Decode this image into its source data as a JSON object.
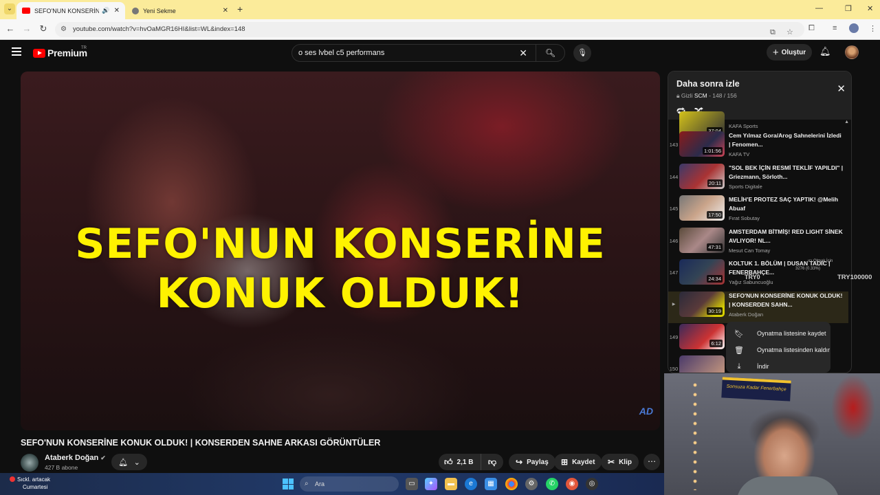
{
  "browser": {
    "tabs": [
      {
        "title": "SEFO'NUN KONSERİNE KO",
        "active": true
      },
      {
        "title": "Yeni Sekme",
        "active": false
      }
    ],
    "url": "youtube.com/watch?v=hvOaMGR16HI&list=WL&index=148"
  },
  "header": {
    "logo_text": "Premium",
    "logo_region": "TR",
    "search_query": "o ses lvbel c5 performans",
    "create_label": "Oluştur"
  },
  "video": {
    "overlay_line1": "SEFO'NUN KONSERİNE",
    "overlay_line2": "KONUK OLDUK!",
    "title": "SEFO'NUN KONSERİNE KONUK OLDUK! | KONSERDEN SAHNE ARKASI GÖRÜNTÜLER",
    "channel": "Ataberk Doğan",
    "subscribers": "427 B abone",
    "likes": "2,1 B",
    "share_label": "Paylaş",
    "save_label": "Kaydet",
    "clip_label": "Klip"
  },
  "playlist": {
    "title": "Daha sonra izle",
    "privacy": "Gizli",
    "owner": "SCM",
    "position": "148 / 156",
    "partial_top": {
      "duration": "37:04",
      "channel": "KAFA Sports"
    },
    "items": [
      {
        "index": "143",
        "title": "Cem Yılmaz Gora/Arog Sahnelerini İzledi | Fenomen...",
        "channel": "KAFA TV",
        "duration": "1:01:56"
      },
      {
        "index": "144",
        "title": "\"SOL BEK İÇİN RESMİ TEKLİF YAPILDI\" | Griezmann, Sörloth...",
        "channel": "Sports Digitale",
        "duration": "20:11"
      },
      {
        "index": "145",
        "title": "MELİH'E PROTEZ SAÇ YAPTIK! @Melih Abuaf",
        "channel": "Fırat Sobutay",
        "duration": "17:50"
      },
      {
        "index": "146",
        "title": "AMSTERDAM BİTMİŞ! RED LIGHT SİNEK AVLIYOR! NL...",
        "channel": "Mesut Can Tomay",
        "duration": "47:31"
      },
      {
        "index": "147",
        "title": "KOLTUK 1. BÖLÜM | DUSAN TADIC | FENERBAHÇE...",
        "channel": "Yağız Sabuncuoğlu",
        "duration": "24:34"
      },
      {
        "index": "▶",
        "title": "SEFO'NUN KONSERİNE KONUK OLDUK! | KONSERDEN SAHN...",
        "channel": "Ataberk Doğan",
        "duration": "30:19"
      },
      {
        "index": "149",
        "title": "",
        "channel": "",
        "duration": "6:12"
      },
      {
        "index": "150",
        "title": "",
        "channel": "",
        "duration": ""
      }
    ]
  },
  "context_menu": {
    "items": [
      {
        "label": "Oynatma listesine kaydet",
        "icon": "bookmark-icon"
      },
      {
        "label": "Oynatma listesinden kaldır",
        "icon": "trash-icon"
      },
      {
        "label": "İndir",
        "icon": "download-icon"
      }
    ]
  },
  "stream_overlay": {
    "ticker_left": "TRY0",
    "ticker_right": "TRY100000",
    "small_text": "3276 (0.33%)",
    "small_text_top": "ıcı Olmak İçin"
  },
  "webcam": {
    "banner_text": "Sonsuza Kadar Fenerbahçe"
  },
  "taskbar": {
    "weather_line1": "Sıckl. artacak",
    "weather_line2": "Cumartesi",
    "search_placeholder": "Ara"
  },
  "colors": {
    "yt_bg": "#0f0f0f",
    "yt_red": "#ff0000",
    "overlay_yellow": "#fff200",
    "chrome_tabbar": "#fbeb9a"
  }
}
